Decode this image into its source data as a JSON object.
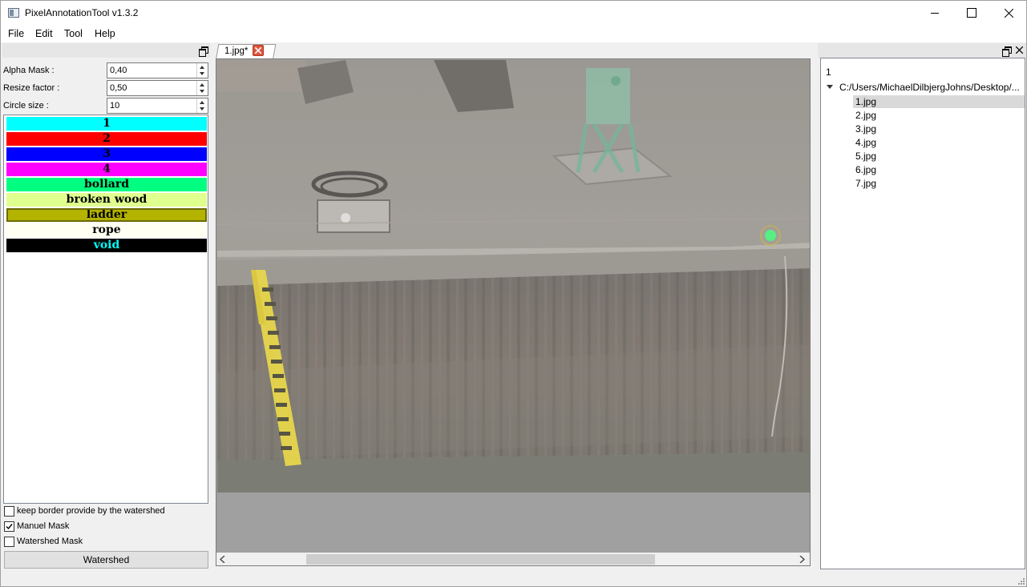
{
  "window": {
    "title": "PixelAnnotationTool v1.3.2"
  },
  "menu": {
    "items": [
      "File",
      "Edit",
      "Tool",
      "Help"
    ]
  },
  "left_panel": {
    "fields": [
      {
        "label": "Alpha Mask :",
        "value": "0,40"
      },
      {
        "label": "Resize factor :",
        "value": "0,50"
      },
      {
        "label": "Circle size :",
        "value": "10"
      }
    ],
    "labels": [
      {
        "name": "1",
        "bg": "#00ffff",
        "color": "#000000"
      },
      {
        "name": "2",
        "bg": "#ff0000",
        "color": "#000000"
      },
      {
        "name": "3",
        "bg": "#0000ff",
        "color": "#000000"
      },
      {
        "name": "4",
        "bg": "#ff00ff",
        "color": "#000000"
      },
      {
        "name": "bollard",
        "bg": "#00ff80",
        "color": "#000000"
      },
      {
        "name": "broken wood",
        "bg": "#dfff8f",
        "color": "#000000"
      },
      {
        "name": "ladder",
        "bg": "#b3b300",
        "color": "#000000",
        "selected": true
      },
      {
        "name": "rope",
        "bg": "#fffff2",
        "color": "#000000"
      },
      {
        "name": "void",
        "bg": "#000000",
        "color": "#00ffff"
      }
    ],
    "checkboxes": [
      {
        "label": "keep border provide by the watershed",
        "checked": false
      },
      {
        "label": "Manuel Mask",
        "checked": true
      },
      {
        "label": "Watershed Mask",
        "checked": false
      }
    ],
    "watershed_button": "Watershed"
  },
  "editor": {
    "tab_label": "1.jpg*"
  },
  "right_panel": {
    "header": "1",
    "root_path": "C:/Users/MichaelDilbjergJohns/Desktop/...",
    "files": [
      "1.jpg",
      "2.jpg",
      "3.jpg",
      "4.jpg",
      "5.jpg",
      "6.jpg",
      "7.jpg"
    ],
    "selected_file": "1.jpg"
  }
}
